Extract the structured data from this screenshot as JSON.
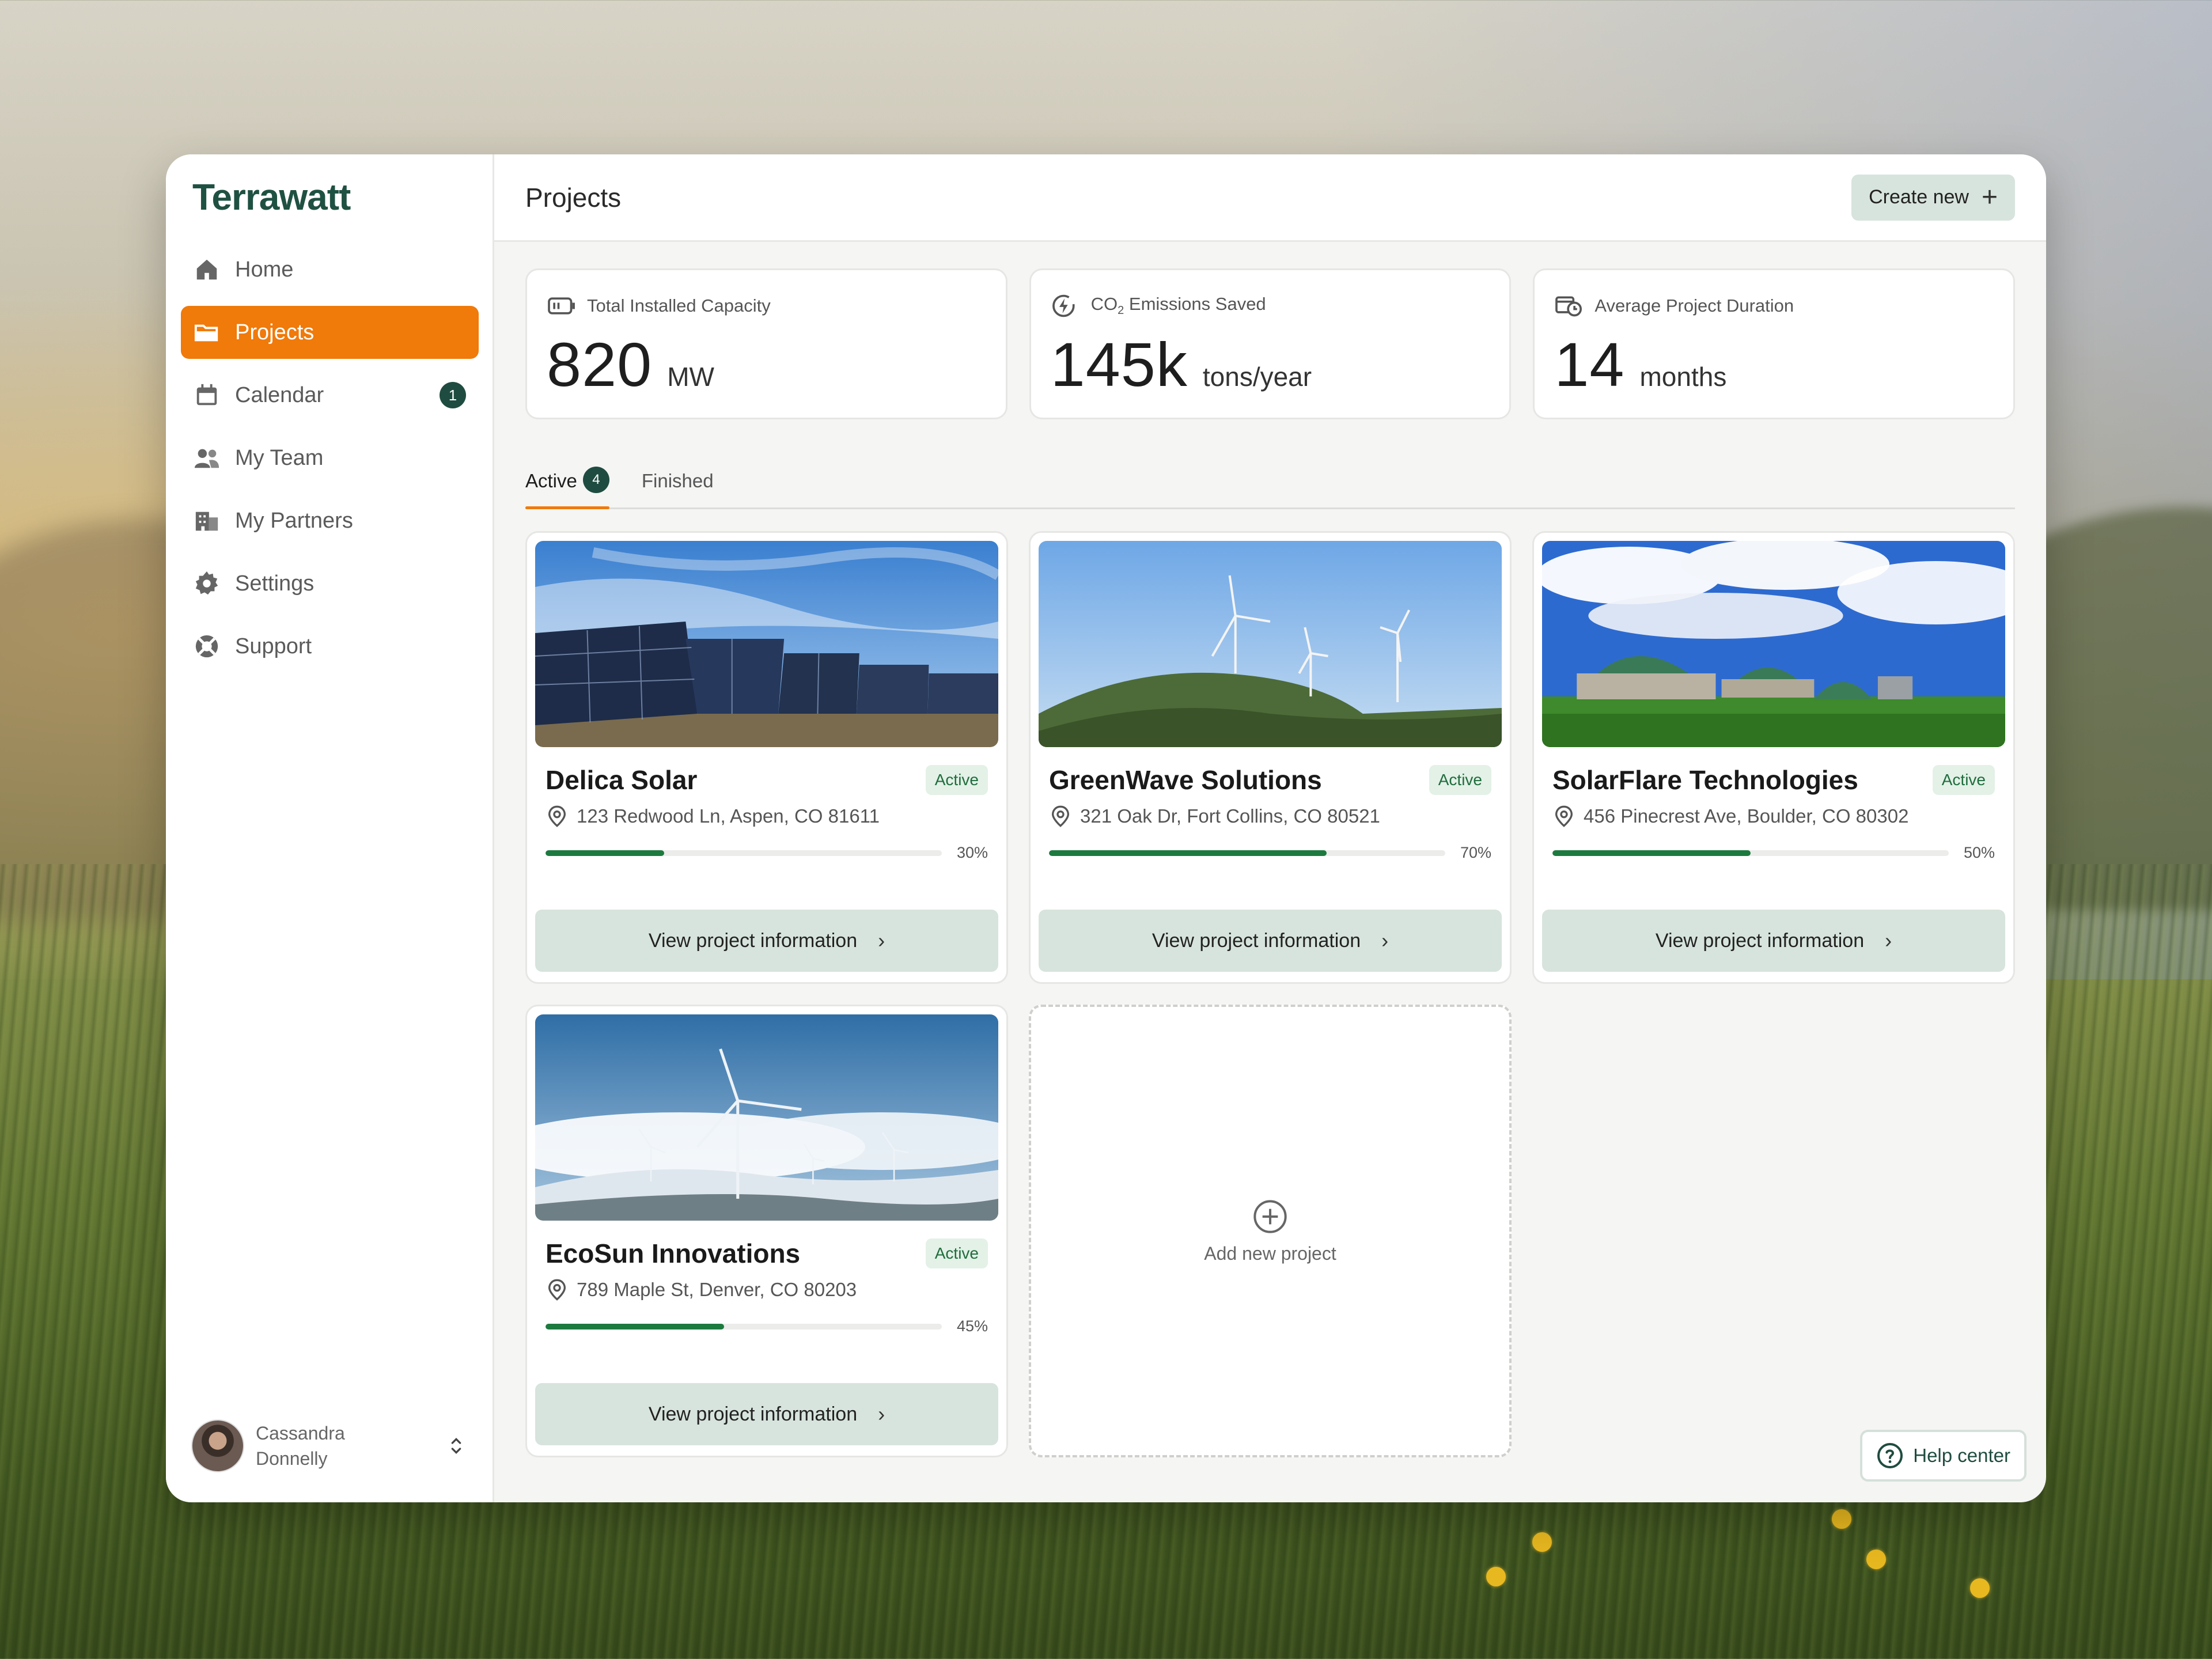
{
  "brand": {
    "name": "Terrawatt",
    "color": "#1f5142",
    "accent": "#f07a0a"
  },
  "sidebar": {
    "items": [
      {
        "label": "Home",
        "icon": "home-icon"
      },
      {
        "label": "Projects",
        "icon": "folder-icon",
        "active": true
      },
      {
        "label": "Calendar",
        "icon": "calendar-icon",
        "badge": "1"
      },
      {
        "label": "My Team",
        "icon": "team-icon"
      },
      {
        "label": "My Partners",
        "icon": "building-icon"
      },
      {
        "label": "Settings",
        "icon": "gear-icon"
      },
      {
        "label": "Support",
        "icon": "lifebuoy-icon"
      }
    ],
    "user": {
      "first": "Cassandra",
      "last": "Donnelly"
    }
  },
  "header": {
    "title": "Projects",
    "create_label": "Create new"
  },
  "stats": [
    {
      "label": "Total Installed Capacity",
      "value": "820",
      "unit": "MW",
      "icon": "battery-icon"
    },
    {
      "label_main": "CO",
      "label_sub": "2",
      "label_rest": " Emissions Saved",
      "value": "145k",
      "unit": "tons/year",
      "icon": "lightning-circle-icon"
    },
    {
      "label": "Average Project Duration",
      "value": "14",
      "unit": "months",
      "icon": "calendar-clock-icon"
    }
  ],
  "tabs": [
    {
      "label": "Active",
      "count": "4",
      "active": true
    },
    {
      "label": "Finished"
    }
  ],
  "projects": [
    {
      "title": "Delica Solar",
      "status": "Active",
      "address": "123 Redwood Ln, Aspen, CO 81611",
      "progress": 30,
      "progress_label": "30%",
      "button": "View project information",
      "image": "solar-panels"
    },
    {
      "title": "GreenWave Solutions",
      "status": "Active",
      "address": "321 Oak Dr, Fort Collins, CO 80521",
      "progress": 70,
      "progress_label": "70%",
      "button": "View project information",
      "image": "wind-turbines-hills"
    },
    {
      "title": "SolarFlare Technologies",
      "status": "Active",
      "address": "456 Pinecrest Ave, Boulder, CO 80302",
      "progress": 50,
      "progress_label": "50%",
      "button": "View project information",
      "image": "biogas-domes"
    },
    {
      "title": "EcoSun Innovations",
      "status": "Active",
      "address": "789 Maple St, Denver, CO 80203",
      "progress": 45,
      "progress_label": "45%",
      "button": "View project information",
      "image": "wind-turbines-snow"
    }
  ],
  "add_project": {
    "label": "Add new project",
    "icon": "plus-circle-icon"
  },
  "help": {
    "label": "Help center",
    "icon": "question-circle-icon"
  }
}
